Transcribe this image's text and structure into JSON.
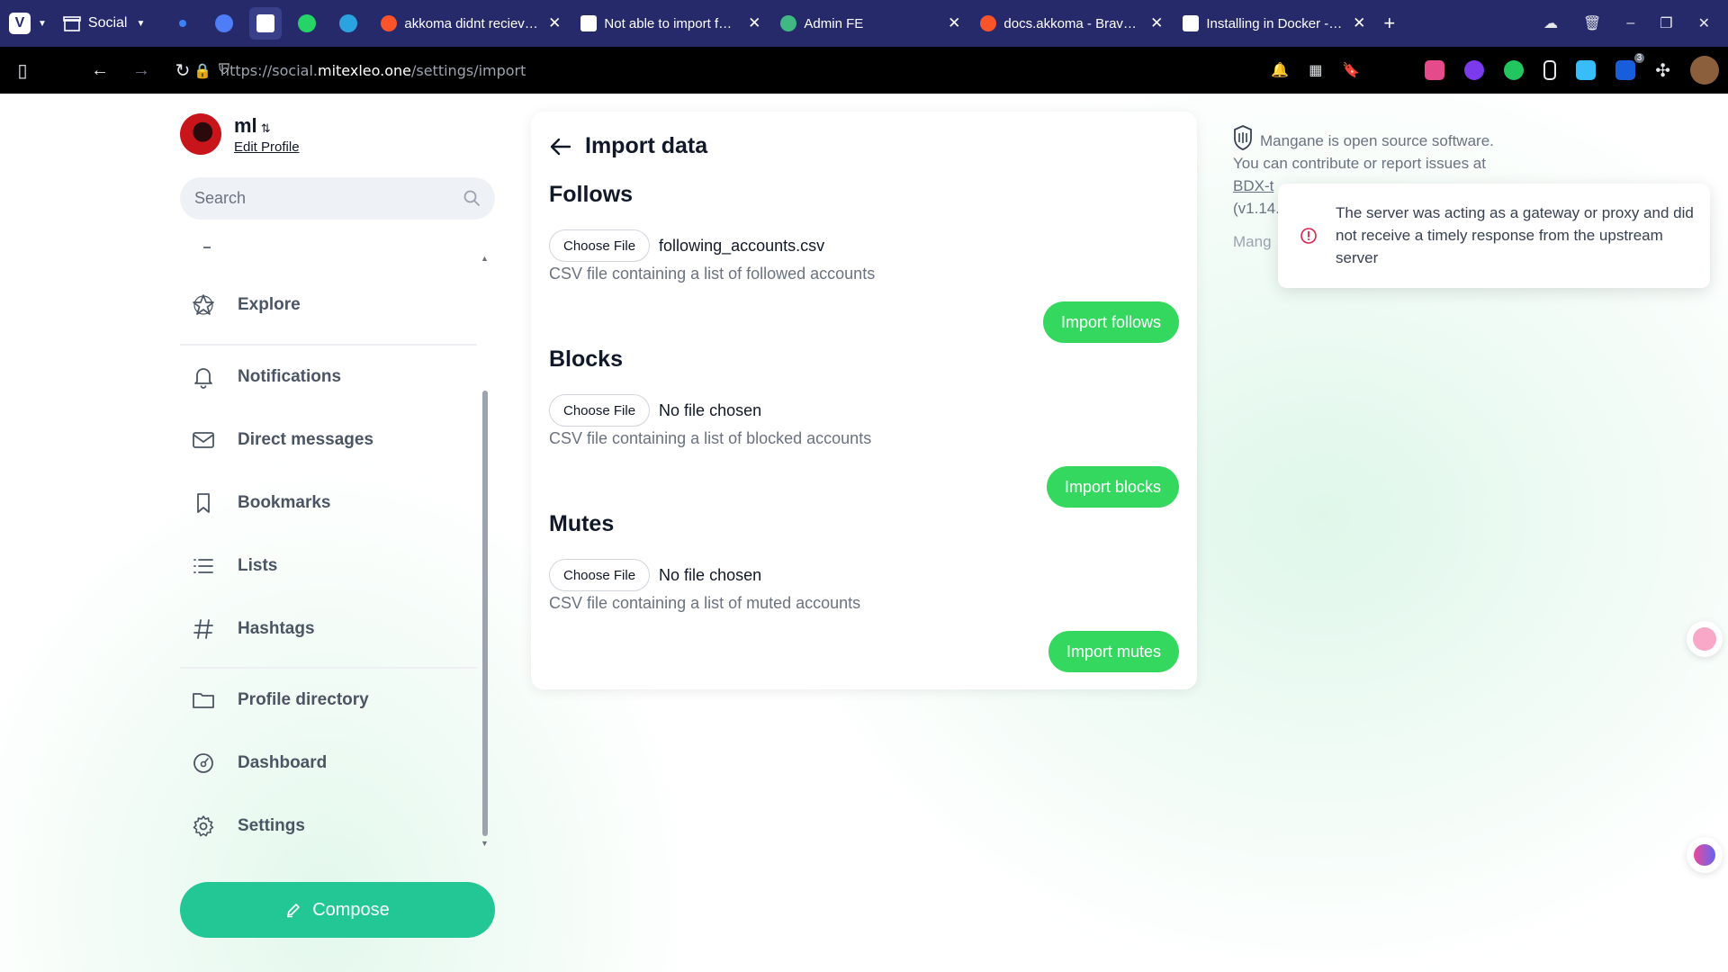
{
  "browser": {
    "workspace": "Social",
    "tabs": [
      {
        "title": "akkoma didnt reciev…",
        "favicon_color": "#f4f4f4"
      },
      {
        "title": "Not able to import f…",
        "favicon_color": "#ffffff"
      },
      {
        "title": "Admin FE",
        "favicon_color": "#3fb883"
      },
      {
        "title": "docs.akkoma - Brav…",
        "favicon_color": "#f4f4f4"
      },
      {
        "title": "Installing in Docker -…",
        "favicon_color": "#ffffff"
      }
    ],
    "url_prefix": "https://social.",
    "url_domain": "mitexleo.one",
    "url_path": "/settings/import",
    "extension_badge": "3"
  },
  "profile": {
    "name": "ml",
    "switch_glyph": "⇅",
    "edit_label": "Edit Profile"
  },
  "search": {
    "placeholder": "Search"
  },
  "nav": {
    "explore": "Explore",
    "notifications": "Notifications",
    "direct_messages": "Direct messages",
    "bookmarks": "Bookmarks",
    "lists": "Lists",
    "hashtags": "Hashtags",
    "profile_directory": "Profile directory",
    "dashboard": "Dashboard",
    "settings": "Settings"
  },
  "compose_label": "Compose",
  "import_page": {
    "title": "Import data",
    "choose_file_label": "Choose File",
    "follows": {
      "title": "Follows",
      "file_name": "following_accounts.csv",
      "hint": "CSV file containing a list of followed accounts",
      "button": "Import follows"
    },
    "blocks": {
      "title": "Blocks",
      "file_name": "No file chosen",
      "hint": "CSV file containing a list of blocked accounts",
      "button": "Import blocks"
    },
    "mutes": {
      "title": "Mutes",
      "file_name": "No file chosen",
      "hint": "CSV file containing a list of muted accounts",
      "button": "Import mutes"
    }
  },
  "about": {
    "line1": "Mangane is open source software.",
    "line2": "You can contribute or report issues at",
    "link": "BDX-t",
    "version": "(v1.14.",
    "line4": "Mang"
  },
  "toast": {
    "message": "The server was acting as a gateway or proxy and did not receive a timely response from the upstream server"
  },
  "colors": {
    "accent": "#23c795",
    "import_button": "#35d85f",
    "tabbar": "#262a6b",
    "error": "#e11d48"
  }
}
